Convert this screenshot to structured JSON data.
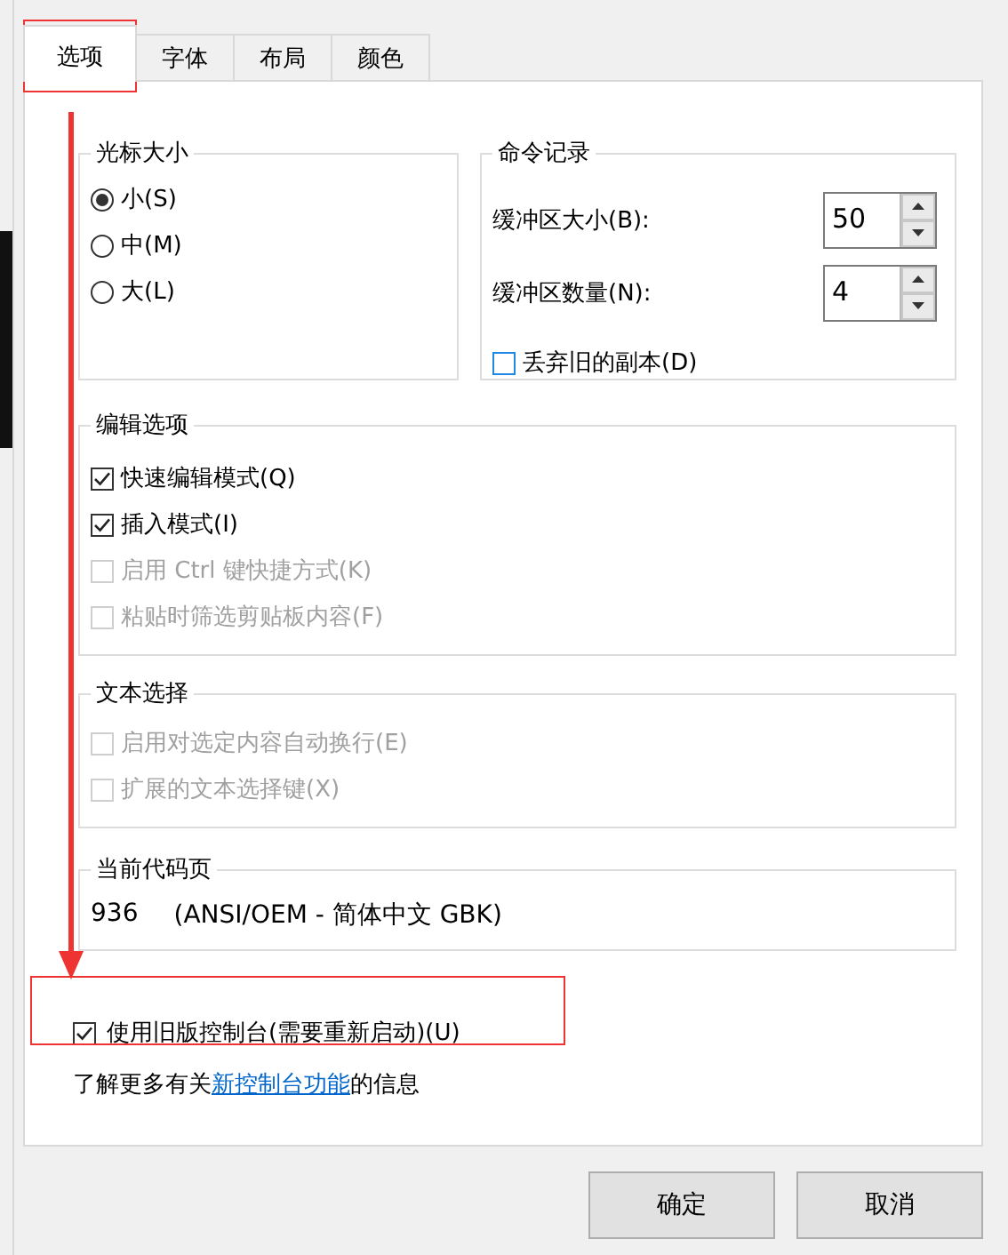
{
  "tabs": [
    {
      "label": "选项",
      "selected": true
    },
    {
      "label": "字体",
      "selected": false
    },
    {
      "label": "布局",
      "selected": false
    },
    {
      "label": "颜色",
      "selected": false
    }
  ],
  "cursor_size": {
    "title": "光标大小",
    "options": [
      {
        "label": "小(S)",
        "selected": true
      },
      {
        "label": "中(M)",
        "selected": false
      },
      {
        "label": "大(L)",
        "selected": false
      }
    ]
  },
  "command_history": {
    "title": "命令记录",
    "fields": [
      {
        "label": "缓冲区大小(B):",
        "value": "50"
      },
      {
        "label": "缓冲区数量(N):",
        "value": "4"
      }
    ],
    "discard_old": {
      "label": "丢弃旧的副本(D)",
      "checked": false
    }
  },
  "edit_options": {
    "title": "编辑选项",
    "items": [
      {
        "label": "快速编辑模式(Q)",
        "checked": true,
        "disabled": false
      },
      {
        "label": "插入模式(I)",
        "checked": true,
        "disabled": false
      },
      {
        "label": "启用 Ctrl 键快捷方式(K)",
        "checked": false,
        "disabled": true
      },
      {
        "label": "粘贴时筛选剪贴板内容(F)",
        "checked": false,
        "disabled": true
      }
    ]
  },
  "text_selection": {
    "title": "文本选择",
    "items": [
      {
        "label": "启用对选定内容自动换行(E)",
        "checked": false,
        "disabled": true
      },
      {
        "label": "扩展的文本选择键(X)",
        "checked": false,
        "disabled": true
      }
    ]
  },
  "code_page": {
    "title": "当前代码页",
    "number": "936",
    "description": "(ANSI/OEM - 简体中文 GBK)"
  },
  "legacy_console": {
    "label": "使用旧版控制台(需要重新启动)(U)",
    "checked": true
  },
  "learn_more": {
    "before": "了解更多有关",
    "link": "新控制台功能",
    "after": "的信息"
  },
  "buttons": [
    {
      "label": "确定"
    },
    {
      "label": "取消"
    }
  ]
}
